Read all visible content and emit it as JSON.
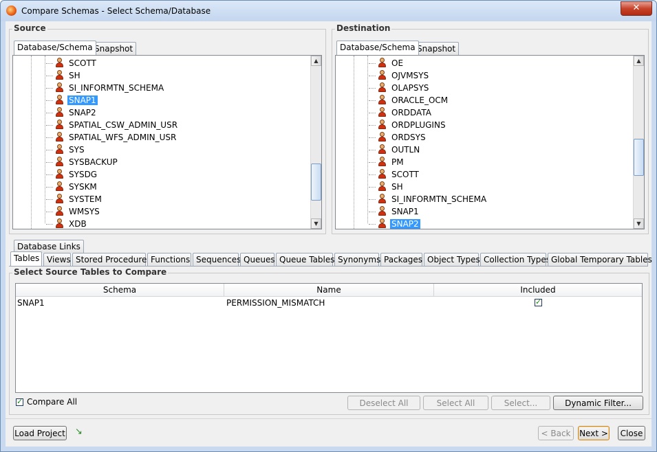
{
  "window": {
    "title": "Compare Schemas - Select Schema/Database",
    "close_label": "✕"
  },
  "source": {
    "group_label": "Source",
    "tabs": [
      "Database/Schema",
      "Snapshot"
    ],
    "items": [
      "SCOTT",
      "SH",
      "SI_INFORMTN_SCHEMA",
      "SNAP1",
      "SNAP2",
      "SPATIAL_CSW_ADMIN_USR",
      "SPATIAL_WFS_ADMIN_USR",
      "SYS",
      "SYSBACKUP",
      "SYSDG",
      "SYSKM",
      "SYSTEM",
      "WMSYS",
      "XDB"
    ],
    "selected": "SNAP1"
  },
  "destination": {
    "group_label": "Destination",
    "tabs": [
      "Database/Schema",
      "Snapshot"
    ],
    "items": [
      "OE",
      "OJVMSYS",
      "OLAPSYS",
      "ORACLE_OCM",
      "ORDDATA",
      "ORDPLUGINS",
      "ORDSYS",
      "OUTLN",
      "PM",
      "SCOTT",
      "SH",
      "SI_INFORMTN_SCHEMA",
      "SNAP1",
      "SNAP2"
    ],
    "selected": "SNAP2"
  },
  "object_tabs": {
    "row1": [
      "Database Links"
    ],
    "row2": [
      "Tables",
      "Views",
      "Stored Procedures",
      "Functions",
      "Sequences",
      "Queues",
      "Queue Tables",
      "Synonyms",
      "Packages",
      "Object Types",
      "Collection Types",
      "Global Temporary Tables"
    ],
    "active": "Tables"
  },
  "tables_panel": {
    "group_label": "Select Source Tables to Compare",
    "columns": [
      "Schema",
      "Name",
      "Included"
    ],
    "rows": [
      {
        "schema": "SNAP1",
        "name": "PERMISSION_MISMATCH",
        "included": true
      }
    ],
    "compare_all_label": "Compare All",
    "compare_all_checked": true,
    "deselect_all_label": "Deselect All",
    "select_all_label": "Select All",
    "select_label": "Select...",
    "dynamic_filter_label": "Dynamic Filter..."
  },
  "footer": {
    "load_project_label": "Load Project",
    "back_label": "< Back",
    "next_label": "Next >",
    "close_label": "Close"
  }
}
